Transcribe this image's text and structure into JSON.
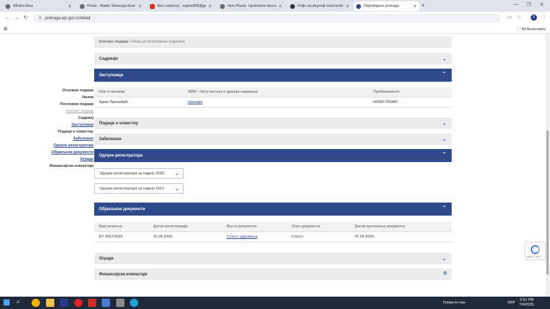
{
  "browser": {
    "tabs": [
      {
        "title": "What's New",
        "color": "#6b6b6b"
      },
      {
        "title": "Posts - Radio Televizija Novi Pa…",
        "color": "#6b6b6b"
      },
      {
        "title": "Bez naslova) - sajme808@gm…",
        "color": "#d93025"
      },
      {
        "title": "Novi Pazar: Upotrebno dozvoli…",
        "color": "#6b6b6b"
      },
      {
        "title": "Polje na deponiji Golo brdo",
        "color": "#333333"
      },
      {
        "title": "Objedinjena pretraga",
        "color": "#2e4a8c"
      }
    ],
    "new_tab": "+",
    "url": "pretraga.apr.gov.rs/detail",
    "profile_initial": "S",
    "all_bookmarks": "All Bookmarks"
  },
  "breadcrumb": {
    "strong": "Контакт подаци",
    "rest": " / Нема регистрованих података"
  },
  "sections": {
    "sadrzaj": "Садржаје",
    "zastupnici": "Заступници",
    "podaci_o_clanstvu": "Подаци о чланству",
    "zabeleske": "Забелешке",
    "odluke": "Одлуке регистратора",
    "objavljeni": "Објављени документи",
    "ograde": "Ограде",
    "finansijski": "Финансијски извештаји"
  },
  "zastupnici_table": {
    "headers": [
      "Име и презиме",
      "ЈМБГ / Број пасоша и држава издавања",
      "Пребивалиште"
    ],
    "rows": [
      [
        "Адем Прешевић",
        "прикажи",
        "НОВИ ПАЗАР"
      ]
    ]
  },
  "odluke_dropdowns": [
    "Одлуке регистратора за годину 2025.",
    "Одлуке регистратора за годину 2021."
  ],
  "docs_table": {
    "headers": [
      "Број решења",
      "Датум регистрације",
      "Врста документа",
      "Опис документа",
      "Датум доношења документа"
    ],
    "rows": [
      [
        "БУ 3657/2025",
        "15.05.2025.",
        "Статут удружења",
        "Статут",
        "07.05.2025."
      ]
    ]
  },
  "sidenav": [
    {
      "label": "Основни подаци",
      "style": "bold"
    },
    {
      "label": "Назив",
      "style": "bold"
    },
    {
      "label": "Пословни подаци",
      "style": "bold"
    },
    {
      "label": "Контакт подаци",
      "style": "muted"
    },
    {
      "label": "Садржај",
      "style": "bold"
    },
    {
      "label": "Заступници",
      "style": "link"
    },
    {
      "label": "Подаци о чланству",
      "style": "bold"
    },
    {
      "label": "Забелешке",
      "style": "link"
    },
    {
      "label": "Одлуке регистратора",
      "style": "link"
    },
    {
      "label": "Објављени документи",
      "style": "link"
    },
    {
      "label": "Ограде",
      "style": "link"
    },
    {
      "label": "Финансијски извештаји",
      "style": "bold"
    }
  ],
  "recaptcha_text": "Privacy - Terms",
  "taskbar": {
    "weather": "Tempo to rise",
    "lang": "SRP",
    "time": "2:51 PM",
    "date": "7/4/2025"
  },
  "colors": {
    "primary": "#2e4a8c",
    "section_gray": "#ececec"
  }
}
